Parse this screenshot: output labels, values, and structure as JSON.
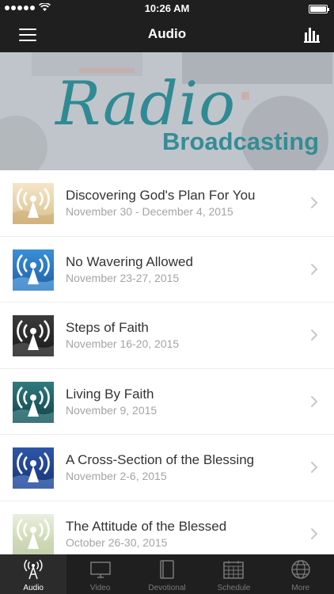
{
  "status": {
    "time": "10:26 AM"
  },
  "nav": {
    "title": "Audio"
  },
  "banner": {
    "line1": "Radio",
    "line2": "Broadcasting"
  },
  "items": [
    {
      "title": "Discovering God's Plan For You",
      "date": "November 30 - December 4, 2015",
      "thumb": "warm"
    },
    {
      "title": "No Wavering Allowed",
      "date": "November 23-27, 2015",
      "thumb": "blue"
    },
    {
      "title": "Steps of Faith",
      "date": "November 16-20, 2015",
      "thumb": "dark"
    },
    {
      "title": "Living By Faith",
      "date": "November 9, 2015",
      "thumb": "teal"
    },
    {
      "title": "A Cross-Section of the Blessing",
      "date": "November 2-6, 2015",
      "thumb": "navy"
    },
    {
      "title": "The Attitude of the Blessed",
      "date": "October 26-30, 2015",
      "thumb": "light"
    }
  ],
  "tabs": [
    {
      "label": "Audio",
      "icon": "radio-tower-icon",
      "active": true
    },
    {
      "label": "Video",
      "icon": "monitor-icon",
      "active": false
    },
    {
      "label": "Devotional",
      "icon": "book-icon",
      "active": false
    },
    {
      "label": "Schedule",
      "icon": "calendar-icon",
      "active": false
    },
    {
      "label": "More",
      "icon": "globe-icon",
      "active": false
    }
  ],
  "colors": {
    "bar": "#1f1f1f",
    "accent": "#2f8a93",
    "title": "#333333",
    "subtitle": "#a4a4a4"
  }
}
